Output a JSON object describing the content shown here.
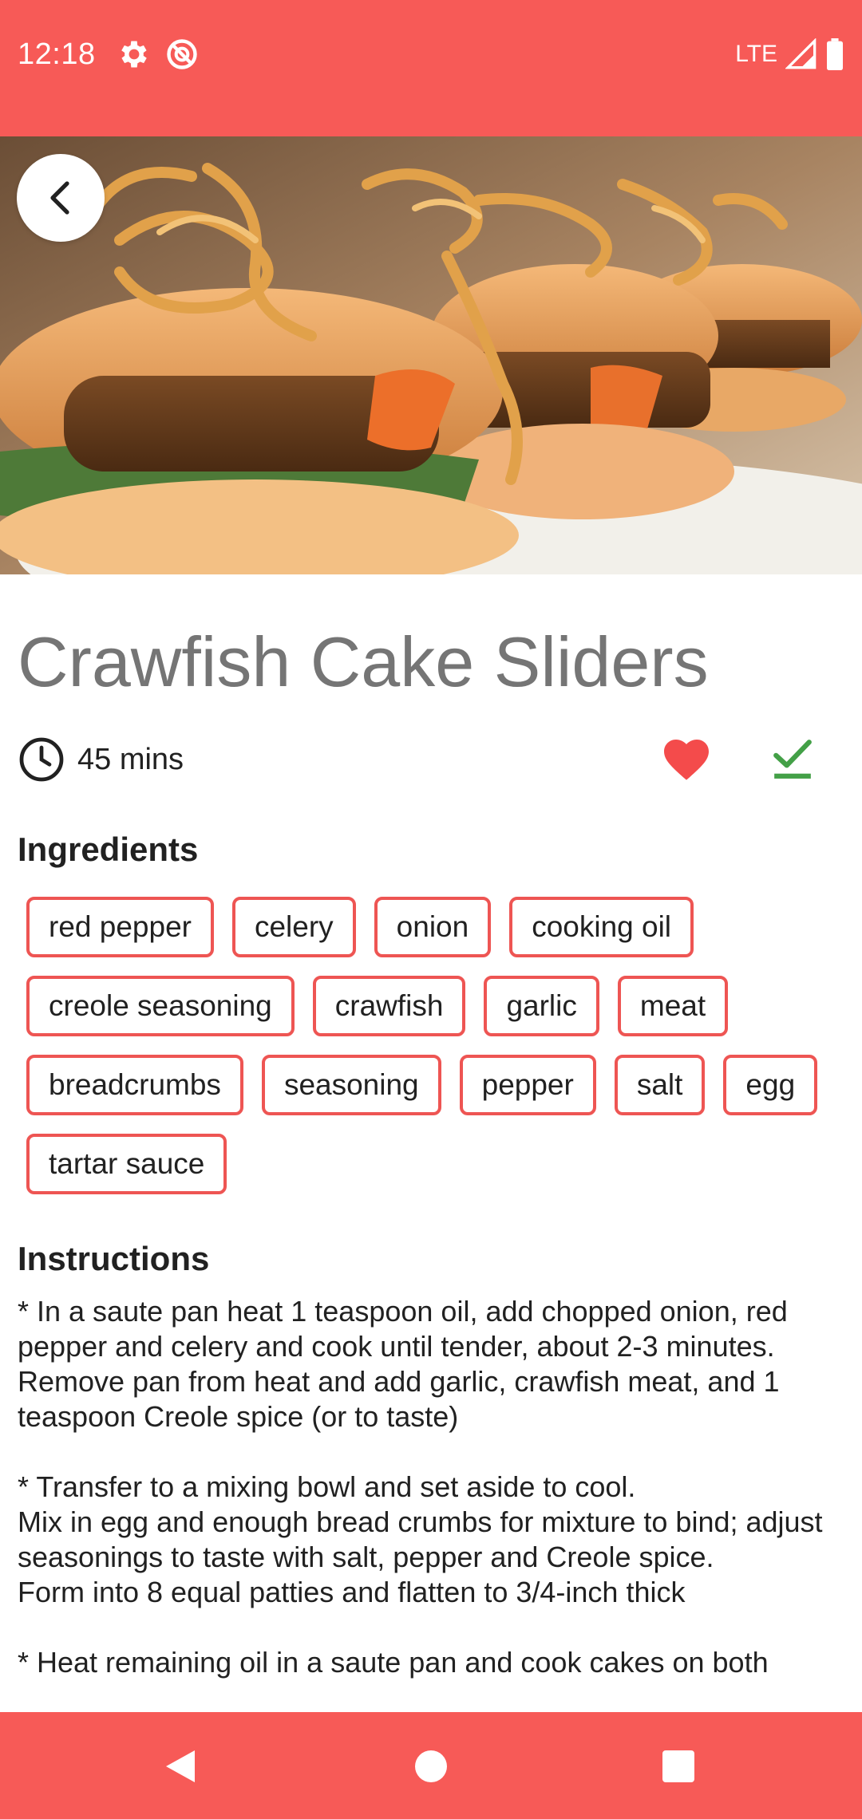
{
  "status_bar": {
    "time": "12:18",
    "network": "LTE",
    "icons": [
      "settings-icon",
      "do-not-disturb-icon",
      "signal-icon",
      "battery-icon"
    ]
  },
  "hero": {
    "image_description_icon": "food-photo",
    "back_icon": "chevron-left-icon"
  },
  "recipe": {
    "title": "Crawfish Cake Sliders",
    "duration": "45 mins",
    "favorite": true,
    "done": true
  },
  "ingredients": {
    "heading": "Ingredients",
    "rows": [
      [
        "red pepper",
        "celery",
        "onion",
        "cooking oil"
      ],
      [
        "creole seasoning",
        "crawfish",
        "garlic",
        "meat"
      ],
      [
        "breadcrumbs",
        "seasoning",
        "pepper",
        "salt",
        "egg"
      ],
      [
        "tartar sauce"
      ]
    ]
  },
  "instructions": {
    "heading": "Instructions",
    "paragraphs": [
      "* In a saute pan heat 1 teaspoon oil, add chopped onion, red pepper and celery and cook until tender, about 2-3 minutes. Remove pan from heat and add garlic, crawfish meat, and 1 teaspoon Creole spice (or to taste)",
      "* Transfer to a mixing bowl and set aside to cool.\nMix in egg and enough bread crumbs for mixture to bind; adjust seasonings to taste with salt, pepper and Creole spice.\nForm into 8 equal patties and flatten to 3/4-inch thick",
      "* Heat remaining oil in a saute pan and cook cakes on both"
    ]
  },
  "colors": {
    "accent": "#f75a57",
    "chip_border": "#ee5553",
    "heart": "#f44b4b",
    "check": "#43a047",
    "title": "#757575"
  },
  "nav_bar": {
    "icons": [
      "back-triangle-icon",
      "home-circle-icon",
      "recents-square-icon"
    ]
  }
}
